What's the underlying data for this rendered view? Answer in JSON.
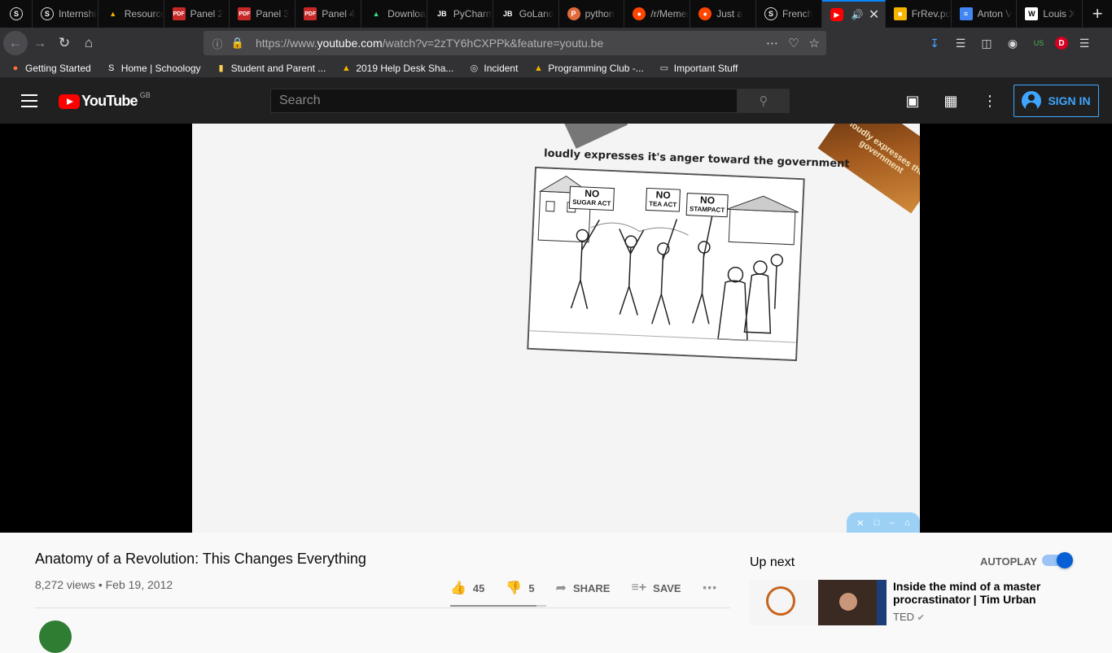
{
  "browser": {
    "tabs": [
      {
        "label": "",
        "icon": "schoology-icon"
      },
      {
        "label": "Internship",
        "icon": "schoology-icon"
      },
      {
        "label": "Resources",
        "icon": "google-drive-icon"
      },
      {
        "label": "Panel 2",
        "icon": "pdf-icon"
      },
      {
        "label": "Panel 3",
        "icon": "pdf-icon"
      },
      {
        "label": "Panel 4",
        "icon": "pdf-icon"
      },
      {
        "label": "Download",
        "icon": "android-icon"
      },
      {
        "label": "PyCharm",
        "icon": "jetbrains-icon"
      },
      {
        "label": "GoLand",
        "icon": "jetbrains-icon"
      },
      {
        "label": "python",
        "icon": "python-icon"
      },
      {
        "label": "/r/Memes",
        "icon": "reddit-icon"
      },
      {
        "label": "Just a",
        "icon": "reddit-icon"
      },
      {
        "label": "French",
        "icon": "schoology-icon"
      },
      {
        "label": "",
        "icon": "youtube-icon",
        "active": true
      },
      {
        "label": "FrRev.pdf",
        "icon": "slides-icon"
      },
      {
        "label": "Anton V",
        "icon": "docs-icon"
      },
      {
        "label": "Louis X",
        "icon": "wikipedia-icon"
      }
    ],
    "url_prefix": "https://www.",
    "url_domain": "youtube.com",
    "url_path": "/watch?v=2zTY6hCXPPk&feature=youtu.be",
    "bookmarks": [
      {
        "label": "Getting Started",
        "icon": "firefox-icon"
      },
      {
        "label": "Home | Schoology",
        "icon": "schoology-icon"
      },
      {
        "label": "Student and Parent ...",
        "icon": "doc-icon"
      },
      {
        "label": "2019 Help Desk Sha...",
        "icon": "google-drive-icon"
      },
      {
        "label": "Incident",
        "icon": "globe-icon"
      },
      {
        "label": "Programming Club -...",
        "icon": "google-drive-icon"
      },
      {
        "label": "Important Stuff",
        "icon": "folder-icon"
      }
    ],
    "badge_us": "US",
    "avatar_letter": "D"
  },
  "youtube": {
    "logo_text": "YouTube",
    "region": "GB",
    "search_placeholder": "Search",
    "sign_in": "SIGN IN"
  },
  "video_frame": {
    "caption": "loudly expresses it's anger toward the government",
    "signs": [
      {
        "big": "NO",
        "small": "SUGAR ACT"
      },
      {
        "big": "NO",
        "small": "TEA ACT"
      },
      {
        "big": "NO",
        "small": "STAMPACT"
      }
    ],
    "corner_card_text": "loudly expresses the government"
  },
  "video": {
    "title": "Anatomy of a Revolution: This Changes Everything",
    "views": "8,272 views",
    "date": "Feb 19, 2012",
    "likes": "45",
    "dislikes": "5",
    "share": "SHARE",
    "save": "SAVE",
    "like_ratio": 0.9
  },
  "sidebar": {
    "up_next": "Up next",
    "autoplay": "AUTOPLAY",
    "autoplay_on": true,
    "next_title": "Inside the mind of a master procrastinator | Tim Urban",
    "next_channel": "TED"
  }
}
